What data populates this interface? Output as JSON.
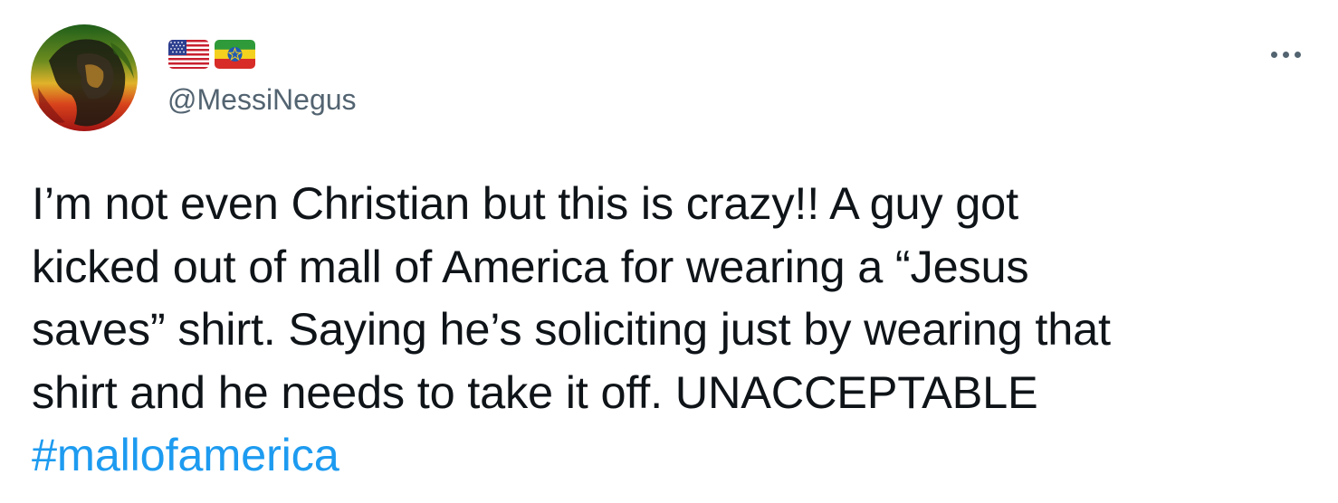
{
  "tweet": {
    "author": {
      "handle": "@MessiNegus",
      "flags": [
        "us-flag-icon",
        "ethiopia-flag-icon"
      ]
    },
    "body_lines": [
      "I’m not even Christian but this is crazy!! A guy got",
      "kicked out of mall of America for wearing a “Jesus",
      "saves” shirt. Saying he’s soliciting just by wearing that",
      "shirt and he needs to take it off. UNACCEPTABLE"
    ],
    "hashtag": "#mallofamerica",
    "more_icon": "more-options-icon"
  },
  "colors": {
    "text": "#0f1419",
    "secondary": "#536471",
    "link": "#1d9bf0",
    "background": "#ffffff"
  }
}
